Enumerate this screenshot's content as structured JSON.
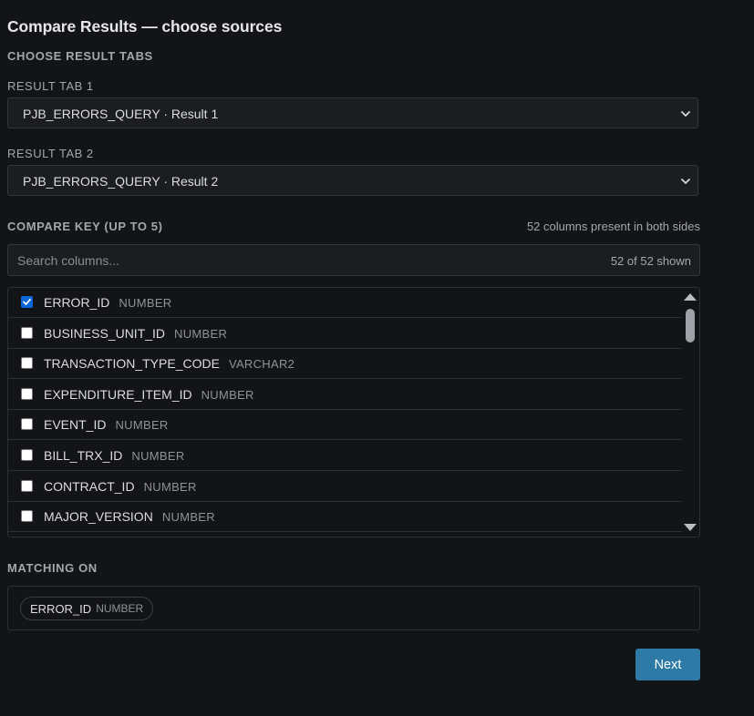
{
  "page_title": "Compare Results — choose sources",
  "choose_tabs_heading": "CHOOSE RESULT TABS",
  "result_tab_1": {
    "label": "RESULT TAB 1",
    "selected": "PJB_ERRORS_QUERY · Result 1"
  },
  "result_tab_2": {
    "label": "RESULT TAB 2",
    "selected": "PJB_ERRORS_QUERY · Result 2"
  },
  "compare_key": {
    "heading": "COMPARE KEY (UP TO 5)",
    "info": "52 columns present in both sides"
  },
  "search": {
    "placeholder": "Search columns...",
    "value": "",
    "count_text": "52 of 52 shown"
  },
  "columns": [
    {
      "name": "ERROR_ID",
      "type": "NUMBER",
      "checked": true
    },
    {
      "name": "BUSINESS_UNIT_ID",
      "type": "NUMBER",
      "checked": false
    },
    {
      "name": "TRANSACTION_TYPE_CODE",
      "type": "VARCHAR2",
      "checked": false
    },
    {
      "name": "EXPENDITURE_ITEM_ID",
      "type": "NUMBER",
      "checked": false
    },
    {
      "name": "EVENT_ID",
      "type": "NUMBER",
      "checked": false
    },
    {
      "name": "BILL_TRX_ID",
      "type": "NUMBER",
      "checked": false
    },
    {
      "name": "CONTRACT_ID",
      "type": "NUMBER",
      "checked": false
    },
    {
      "name": "MAJOR_VERSION",
      "type": "NUMBER",
      "checked": false
    }
  ],
  "matching_on": {
    "heading": "MATCHING ON",
    "chips": [
      {
        "name": "ERROR_ID",
        "type": "NUMBER"
      }
    ]
  },
  "next_label": "Next",
  "colors": {
    "accent": "#2e7aa6",
    "checkbox_checked": "#0b66d8",
    "background": "#131417"
  }
}
